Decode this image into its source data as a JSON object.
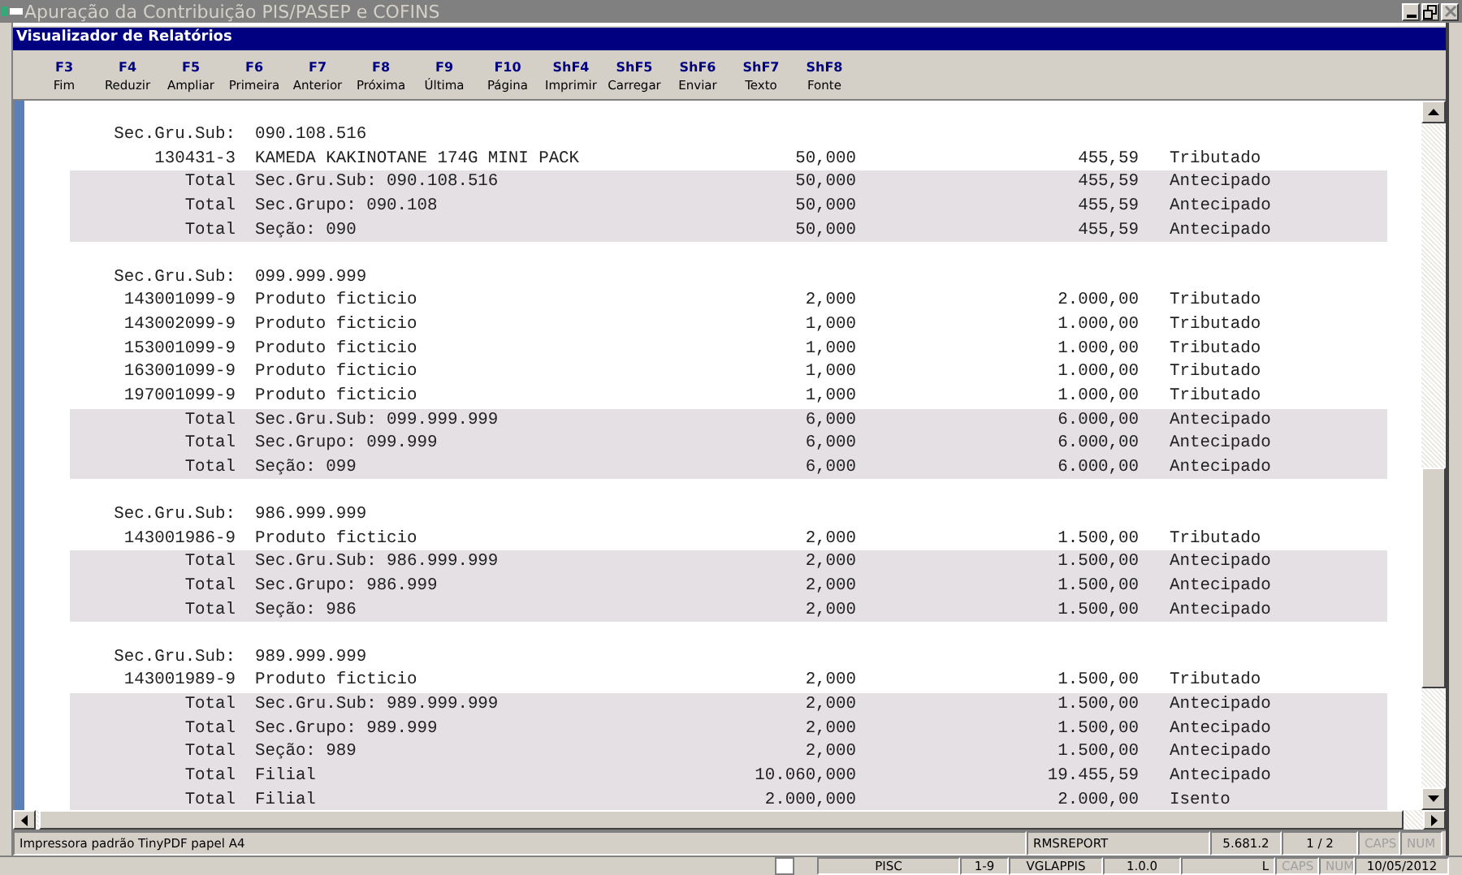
{
  "window": {
    "title": "Apuração da Contribuição PIS/PASEP e COFINS"
  },
  "viewer": {
    "title": "Visualizador de Relatórios"
  },
  "toolbar": [
    {
      "key": "F3",
      "label": "Fim"
    },
    {
      "key": "F4",
      "label": "Reduzir"
    },
    {
      "key": "F5",
      "label": "Ampliar"
    },
    {
      "key": "F6",
      "label": "Primeira"
    },
    {
      "key": "F7",
      "label": "Anterior"
    },
    {
      "key": "F8",
      "label": "Próxima"
    },
    {
      "key": "F9",
      "label": "Última"
    },
    {
      "key": "F10",
      "label": "Página"
    },
    {
      "key": "ShF4",
      "label": "Imprimir"
    },
    {
      "key": "ShF5",
      "label": "Carregar"
    },
    {
      "key": "ShF6",
      "label": "Enviar"
    },
    {
      "key": "ShF7",
      "label": "Texto"
    },
    {
      "key": "ShF8",
      "label": "Fonte"
    }
  ],
  "report": [
    {
      "kind": "header",
      "label": "Sec.Gru.Sub:",
      "value": "090.108.516"
    },
    {
      "kind": "item",
      "code": "130431-3",
      "description": "KAMEDA KAKINOTANE 174G MINI PACK",
      "quantity": "50,000",
      "amount": "455,59",
      "status": "Tributado"
    },
    {
      "kind": "total",
      "code": "Total",
      "description": "Sec.Gru.Sub: 090.108.516",
      "quantity": "50,000",
      "amount": "455,59",
      "status": "Antecipado"
    },
    {
      "kind": "total",
      "code": "Total",
      "description": "Sec.Grupo: 090.108",
      "quantity": "50,000",
      "amount": "455,59",
      "status": "Antecipado"
    },
    {
      "kind": "total",
      "code": "Total",
      "description": "Seção: 090",
      "quantity": "50,000",
      "amount": "455,59",
      "status": "Antecipado"
    },
    {
      "kind": "blank"
    },
    {
      "kind": "header",
      "label": "Sec.Gru.Sub:",
      "value": "099.999.999"
    },
    {
      "kind": "item",
      "code": "143001099-9",
      "description": "Produto ficticio",
      "quantity": "2,000",
      "amount": "2.000,00",
      "status": "Tributado"
    },
    {
      "kind": "item",
      "code": "143002099-9",
      "description": "Produto ficticio",
      "quantity": "1,000",
      "amount": "1.000,00",
      "status": "Tributado"
    },
    {
      "kind": "item",
      "code": "153001099-9",
      "description": "Produto ficticio",
      "quantity": "1,000",
      "amount": "1.000,00",
      "status": "Tributado"
    },
    {
      "kind": "item",
      "code": "163001099-9",
      "description": "Produto ficticio",
      "quantity": "1,000",
      "amount": "1.000,00",
      "status": "Tributado"
    },
    {
      "kind": "item",
      "code": "197001099-9",
      "description": "Produto ficticio",
      "quantity": "1,000",
      "amount": "1.000,00",
      "status": "Tributado"
    },
    {
      "kind": "total",
      "code": "Total",
      "description": "Sec.Gru.Sub: 099.999.999",
      "quantity": "6,000",
      "amount": "6.000,00",
      "status": "Antecipado"
    },
    {
      "kind": "total",
      "code": "Total",
      "description": "Sec.Grupo: 099.999",
      "quantity": "6,000",
      "amount": "6.000,00",
      "status": "Antecipado"
    },
    {
      "kind": "total",
      "code": "Total",
      "description": "Seção: 099",
      "quantity": "6,000",
      "amount": "6.000,00",
      "status": "Antecipado"
    },
    {
      "kind": "blank"
    },
    {
      "kind": "header",
      "label": "Sec.Gru.Sub:",
      "value": "986.999.999"
    },
    {
      "kind": "item",
      "code": "143001986-9",
      "description": "Produto ficticio",
      "quantity": "2,000",
      "amount": "1.500,00",
      "status": "Tributado"
    },
    {
      "kind": "total",
      "code": "Total",
      "description": "Sec.Gru.Sub: 986.999.999",
      "quantity": "2,000",
      "amount": "1.500,00",
      "status": "Antecipado"
    },
    {
      "kind": "total",
      "code": "Total",
      "description": "Sec.Grupo: 986.999",
      "quantity": "2,000",
      "amount": "1.500,00",
      "status": "Antecipado"
    },
    {
      "kind": "total",
      "code": "Total",
      "description": "Seção: 986",
      "quantity": "2,000",
      "amount": "1.500,00",
      "status": "Antecipado"
    },
    {
      "kind": "blank"
    },
    {
      "kind": "header",
      "label": "Sec.Gru.Sub:",
      "value": "989.999.999"
    },
    {
      "kind": "item",
      "code": "143001989-9",
      "description": "Produto ficticio",
      "quantity": "2,000",
      "amount": "1.500,00",
      "status": "Tributado"
    },
    {
      "kind": "total",
      "code": "Total",
      "description": "Sec.Gru.Sub: 989.999.999",
      "quantity": "2,000",
      "amount": "1.500,00",
      "status": "Antecipado"
    },
    {
      "kind": "total",
      "code": "Total",
      "description": "Sec.Grupo: 989.999",
      "quantity": "2,000",
      "amount": "1.500,00",
      "status": "Antecipado"
    },
    {
      "kind": "total",
      "code": "Total",
      "description": "Seção: 989",
      "quantity": "2,000",
      "amount": "1.500,00",
      "status": "Antecipado"
    },
    {
      "kind": "total",
      "code": "Total",
      "description": "Filial",
      "quantity": "10.060,000",
      "amount": "19.455,59",
      "status": "Antecipado"
    },
    {
      "kind": "total",
      "code": "Total",
      "description": "Filial",
      "quantity": "2.000,000",
      "amount": "2.000,00",
      "status": "Isento"
    }
  ],
  "status_bar": [
    {
      "text": "Impressora padrão TinyPDF papel A4",
      "disabled": false
    },
    {
      "text": "RMSREPORT",
      "disabled": false
    },
    {
      "text": "5.681.2",
      "disabled": false
    },
    {
      "text": "1 / 2",
      "disabled": false
    },
    {
      "text": "CAPS",
      "disabled": true
    },
    {
      "text": "NUM",
      "disabled": true
    }
  ],
  "taskbar": [
    {
      "text": "PISC",
      "disabled": false
    },
    {
      "text": "1-9",
      "disabled": false
    },
    {
      "text": "VGLAPPIS",
      "disabled": false
    },
    {
      "text": "1.0.0",
      "disabled": false
    },
    {
      "text": "L",
      "disabled": false
    },
    {
      "text": "CAPS",
      "disabled": true
    },
    {
      "text": "NUM",
      "disabled": true
    },
    {
      "text": "10/05/2012",
      "disabled": false
    }
  ]
}
